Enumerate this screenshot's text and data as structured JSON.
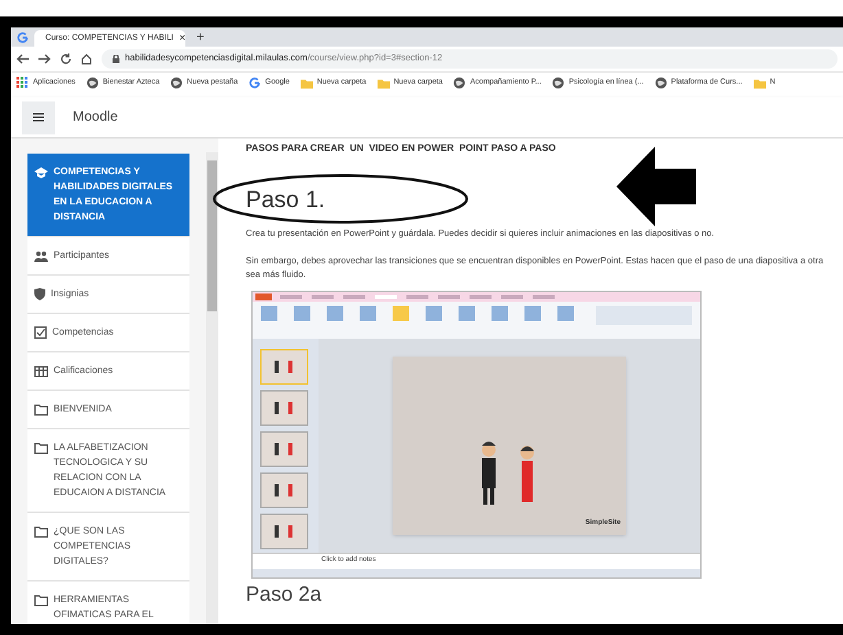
{
  "browser": {
    "tabs": [
      {
        "label": "Curso: COMPETENCIAS Y HABILI",
        "selected": true
      }
    ],
    "new_tab": "+",
    "close": "×",
    "url_host": "habilidadesycompetenciasdigital.milaulas.com",
    "url_path": "/course/view.php?id=3#section-12",
    "bookmarks": [
      {
        "kind": "apps",
        "label": "Aplicaciones"
      },
      {
        "kind": "globe",
        "label": "Bienestar Azteca"
      },
      {
        "kind": "globe",
        "label": "Nueva pestaña"
      },
      {
        "kind": "google",
        "label": "Google"
      },
      {
        "kind": "folder",
        "label": "Nueva carpeta"
      },
      {
        "kind": "folder",
        "label": "Nueva carpeta"
      },
      {
        "kind": "globe",
        "label": "Acompañamiento P..."
      },
      {
        "kind": "globe",
        "label": "Psicología en línea (..."
      },
      {
        "kind": "globe",
        "label": "Plataforma de Curs..."
      },
      {
        "kind": "folder",
        "label": "N"
      }
    ]
  },
  "header": {
    "brand": "Moodle"
  },
  "sidebar": {
    "items": [
      {
        "kind": "course",
        "label": "COMPETENCIAS Y HABILIDADES DIGITALES EN LA EDUCACION A DISTANCIA",
        "selected": true
      },
      {
        "kind": "people",
        "label": "Participantes",
        "selected": false
      },
      {
        "kind": "shield",
        "label": "Insignias",
        "selected": false
      },
      {
        "kind": "check",
        "label": "Competencias",
        "selected": false
      },
      {
        "kind": "table",
        "label": "Calificaciones",
        "selected": false
      },
      {
        "kind": "folder",
        "label": "BIENVENIDA",
        "selected": false
      },
      {
        "kind": "folder",
        "label": "LA ALFABETIZACION TECNOLOGICA Y SU RELACION CON LA EDUCAION A DISTANCIA",
        "selected": false
      },
      {
        "kind": "folder",
        "label": "¿QUE SON LAS COMPETENCIAS DIGITALES?",
        "selected": false
      },
      {
        "kind": "folder",
        "label": "HERRAMIENTAS OFIMATICAS PARA EL",
        "selected": false
      }
    ]
  },
  "content": {
    "title": "PASOS PARA CREAR  UN  VIDEO EN POWER  POINT PASO A PASO",
    "step1": "Paso 1.",
    "paragraphs": [
      "Crea tu presentación en PowerPoint y guárdala. Puedes decidir si quieres incluir animaciones en las diapositivas o no.",
      "Sin embargo, debes aprovechar las transiciones que se encuentran disponibles en PowerPoint. Estas hacen que el paso de una diapositiva a otra sea más fluido."
    ],
    "screenshot": {
      "notes": "Click to add notes",
      "watermark": "SimpleSite"
    },
    "step2": "Paso 2a"
  }
}
